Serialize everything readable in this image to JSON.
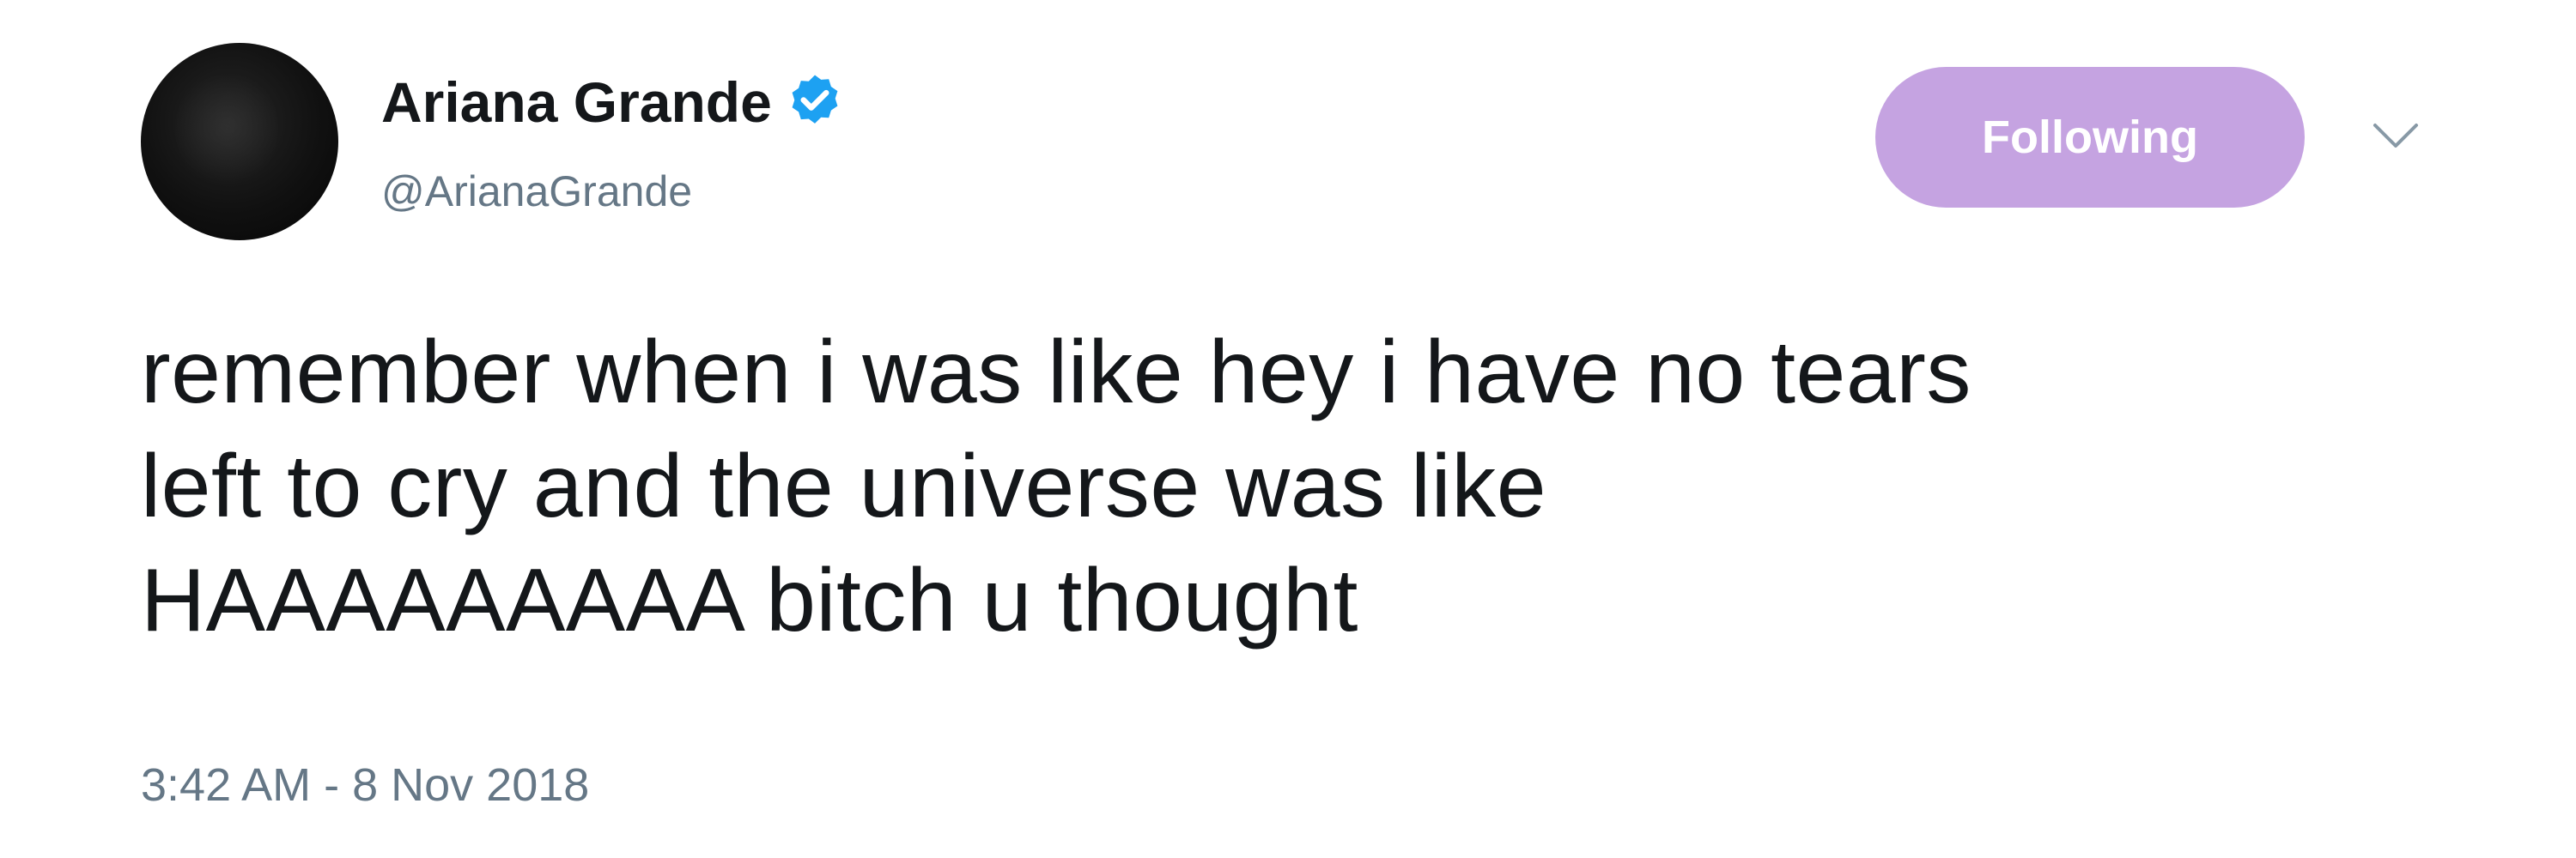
{
  "tweet": {
    "author": {
      "display_name": "Ariana Grande",
      "handle": "@ArianaGrande",
      "verified": true,
      "verified_icon": "verified-badge-icon",
      "verified_color": "#1da1f2"
    },
    "follow_button": {
      "label": "Following",
      "color": "#c5a3e1"
    },
    "menu_icon": "chevron-down-icon",
    "text": "remember when i was like hey i have no tears\nleft to cry and the universe was like\nHAAAAAAAAA bitch u thought",
    "timestamp": "3:42 AM - 8 Nov 2018"
  }
}
